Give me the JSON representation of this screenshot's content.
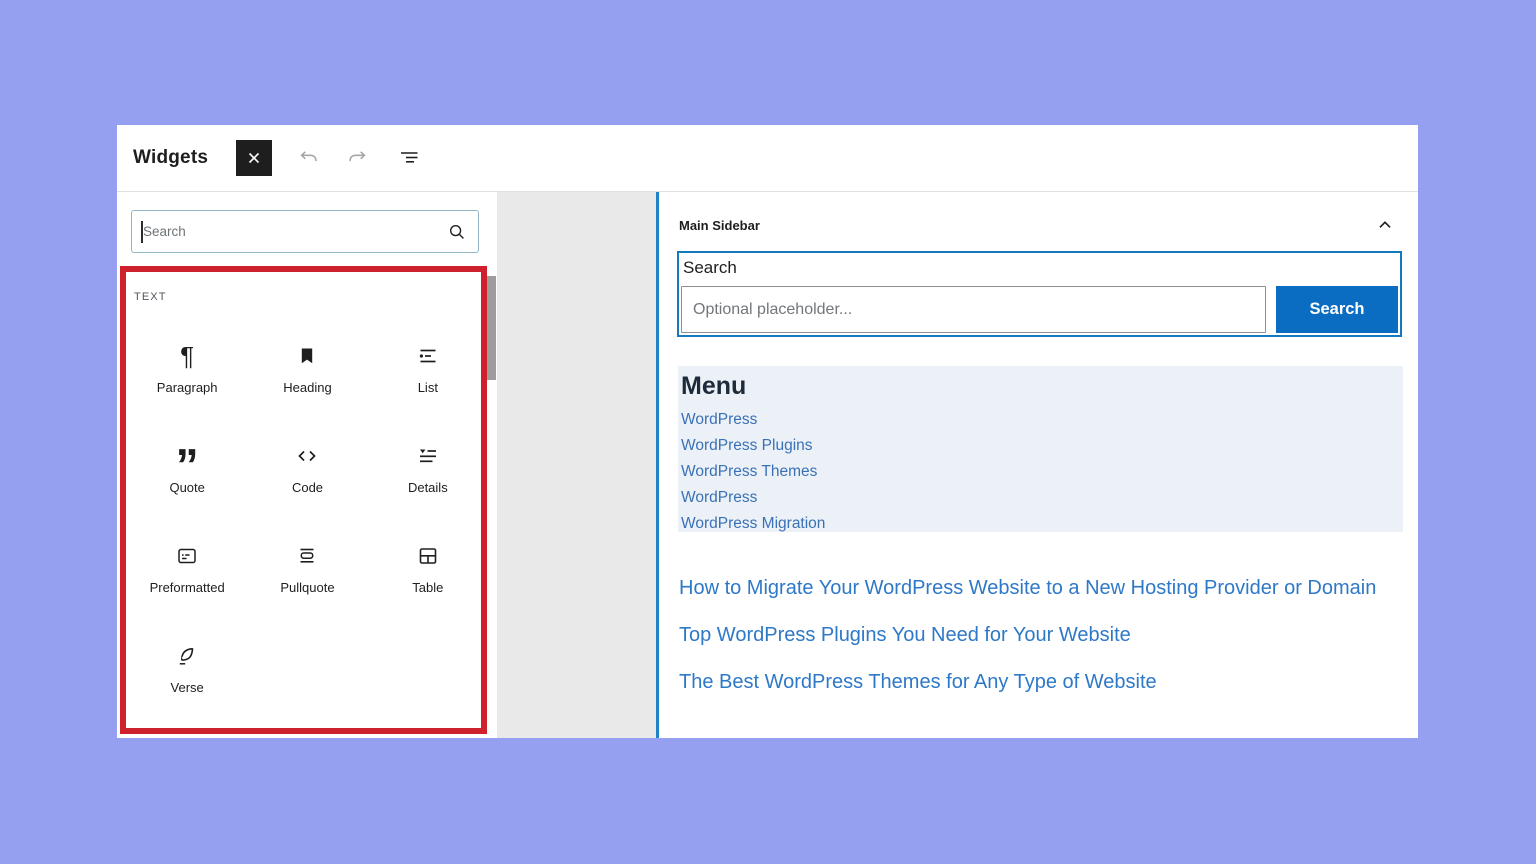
{
  "header": {
    "title": "Widgets"
  },
  "inserter": {
    "search_placeholder": "Search",
    "section_label": "TEXT",
    "blocks": [
      {
        "label": "Paragraph"
      },
      {
        "label": "Heading"
      },
      {
        "label": "List"
      },
      {
        "label": "Quote"
      },
      {
        "label": "Code"
      },
      {
        "label": "Details"
      },
      {
        "label": "Preformatted"
      },
      {
        "label": "Pullquote"
      },
      {
        "label": "Table"
      },
      {
        "label": "Verse"
      }
    ]
  },
  "canvas": {
    "widget_area_title": "Main Sidebar",
    "search_widget": {
      "label": "Search",
      "placeholder": "Optional placeholder...",
      "button_label": "Search"
    },
    "menu_widget": {
      "heading": "Menu",
      "links": [
        "WordPress",
        "WordPress Plugins",
        "WordPress Themes",
        "WordPress",
        "WordPress Migration"
      ]
    },
    "latest_posts": [
      "How to Migrate Your WordPress Website to a New Hosting Provider or Domain",
      "Top WordPress Plugins You Need for Your Website",
      "The Best WordPress Themes for Any Type of Website"
    ]
  },
  "colors": {
    "background_purple": "#96a0f0",
    "annotation_red": "#cf202e",
    "button_blue": "#0b6dc2",
    "selected_block_border": "#1579be",
    "content_edge_blue": "#2083c5",
    "menu_background": "#ebf1f7",
    "link_blue": "#3a71b5",
    "post_link_blue": "#2e78c8"
  }
}
